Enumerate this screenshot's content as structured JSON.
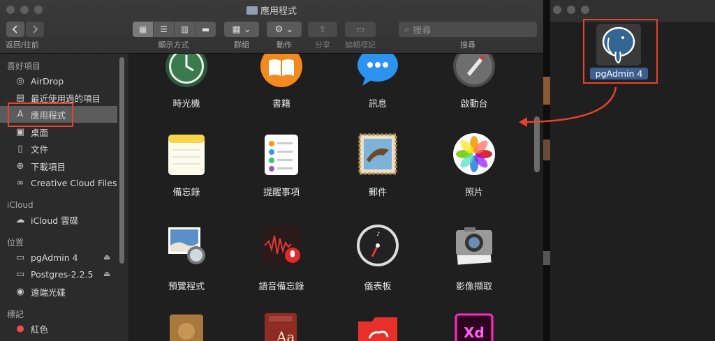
{
  "window": {
    "title": "應用程式"
  },
  "toolbar": {
    "nav_label": "返回/往前",
    "view_label": "顯示方式",
    "group_label": "群組",
    "action_label": "動作",
    "share_label": "分享",
    "tags_label": "編輯標記",
    "search_label": "搜尋",
    "search_placeholder": "搜尋"
  },
  "sidebar": {
    "favorites_header": "喜好項目",
    "favorites": [
      {
        "label": "AirDrop",
        "icon": "airdrop-icon"
      },
      {
        "label": "最近使用過的項目",
        "icon": "clock-icon"
      },
      {
        "label": "應用程式",
        "icon": "applications-icon"
      },
      {
        "label": "桌面",
        "icon": "desktop-icon"
      },
      {
        "label": "文件",
        "icon": "document-icon"
      },
      {
        "label": "下載項目",
        "icon": "download-icon"
      },
      {
        "label": "Creative Cloud Files",
        "icon": "creative-cloud-icon"
      }
    ],
    "icloud_header": "iCloud",
    "icloud": [
      {
        "label": "iCloud 雲碟",
        "icon": "cloud-icon"
      }
    ],
    "locations_header": "位置",
    "locations": [
      {
        "label": "pgAdmin 4",
        "icon": "disk-icon"
      },
      {
        "label": "Postgres-2.2.5",
        "icon": "disk-icon"
      },
      {
        "label": "遠端光碟",
        "icon": "disc-icon"
      }
    ],
    "tags_header": "標記",
    "tags": [
      {
        "label": "紅色",
        "color": "#ef4b4b"
      }
    ]
  },
  "apps": [
    {
      "label": "時光機",
      "icon": "time-machine-icon"
    },
    {
      "label": "書籍",
      "icon": "books-icon"
    },
    {
      "label": "訊息",
      "icon": "messages-icon"
    },
    {
      "label": "啟動台",
      "icon": "launchpad-icon"
    },
    {
      "label": "備忘錄",
      "icon": "notes-icon"
    },
    {
      "label": "提醒事項",
      "icon": "reminders-icon"
    },
    {
      "label": "郵件",
      "icon": "mail-icon"
    },
    {
      "label": "照片",
      "icon": "photos-icon"
    },
    {
      "label": "預覽程式",
      "icon": "preview-icon"
    },
    {
      "label": "語音備忘錄",
      "icon": "voice-memos-icon"
    },
    {
      "label": "儀表板",
      "icon": "dashboard-icon"
    },
    {
      "label": "影像擷取",
      "icon": "image-capture-icon"
    }
  ],
  "partial_apps": [
    {
      "icon": "folder-icon",
      "text": ""
    },
    {
      "icon": "dictionary-icon",
      "text": "Aa"
    },
    {
      "icon": "creative-cloud-folder-icon",
      "text": ""
    },
    {
      "icon": "adobe-xd-icon",
      "text": "Xd"
    }
  ],
  "installer": {
    "label": "pgAdmin 4"
  },
  "colors": {
    "highlight": "#e8432a",
    "selected": "#5c5c5c"
  }
}
